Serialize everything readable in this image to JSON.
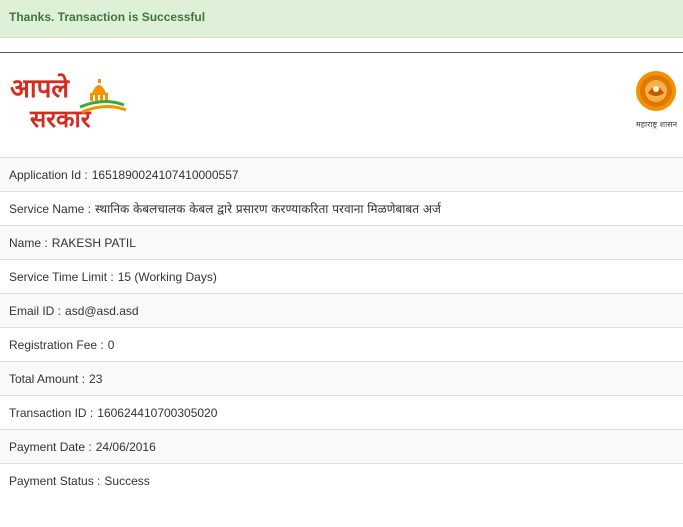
{
  "alert": {
    "message": "Thanks. Transaction is Successful"
  },
  "header": {
    "logo_text_top": "आपले",
    "logo_text_bottom": "सरकार",
    "emblem_label": "महाराष्ट्र शासन",
    "logo_icon": "dome-building-icon",
    "emblem_icon": "state-seal-icon",
    "colors": {
      "logo_red": "#d62b1f",
      "logo_orange": "#f29400",
      "logo_green": "#3aa935",
      "seal_orange": "#f39200"
    }
  },
  "details": [
    {
      "label": "Application Id :",
      "value": "1651890024107410000557"
    },
    {
      "label": "Service Name :",
      "value": "स्थानिक केबलचालक केबल द्वारे प्रसारण करण्याकरिता परवाना मिळणेबाबत अर्ज"
    },
    {
      "label": "Name :",
      "value": "RAKESH PATIL"
    },
    {
      "label": "Service Time Limit :",
      "value": "15 (Working Days)"
    },
    {
      "label": "Email ID :",
      "value": "asd@asd.asd"
    },
    {
      "label": "Registration Fee :",
      "value": "0"
    },
    {
      "label": "Total Amount :",
      "value": "23"
    },
    {
      "label": "Transaction ID :",
      "value": "160624410700305020"
    },
    {
      "label": "Payment Date :",
      "value": "24/06/2016"
    },
    {
      "label": "Payment Status :",
      "value": "Success"
    }
  ]
}
